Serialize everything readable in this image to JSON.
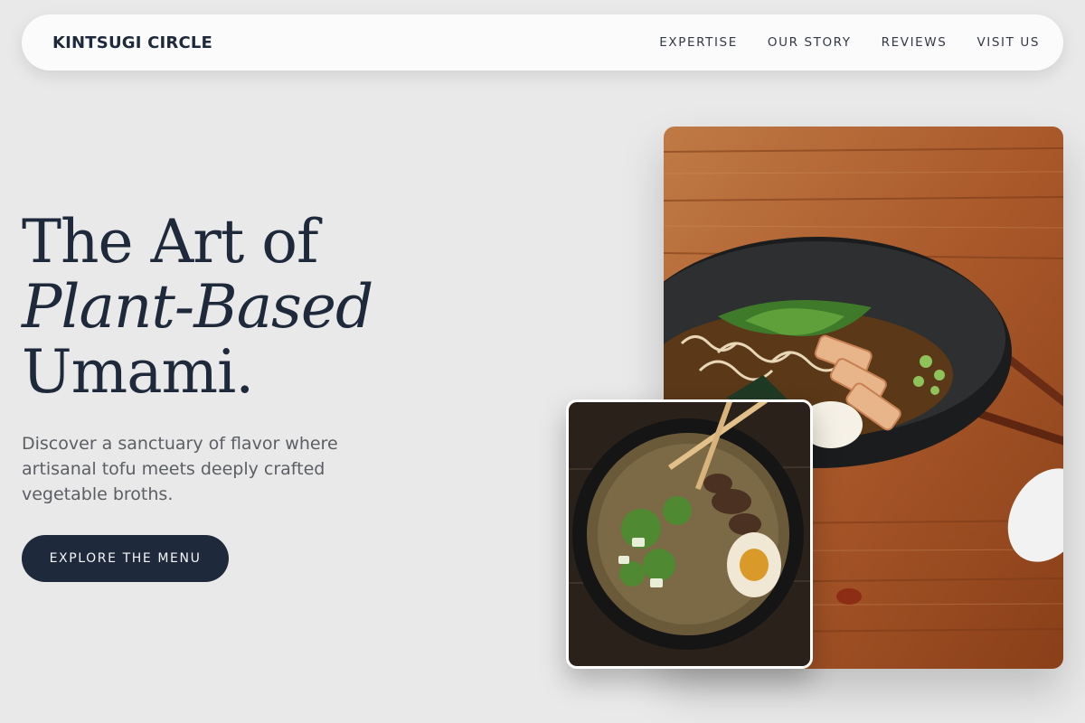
{
  "brand": {
    "name": "KINTSUGI CIRCLE"
  },
  "nav": {
    "items": [
      {
        "label": "EXPERTISE"
      },
      {
        "label": "OUR STORY"
      },
      {
        "label": "REVIEWS"
      },
      {
        "label": "VISIT US"
      }
    ]
  },
  "hero": {
    "title_line1": "The Art of",
    "title_line2": "Plant-Based",
    "title_line3": "Umami.",
    "subtitle": "Discover a sanctuary of flavor where artisanal tofu meets deeply crafted vegetable broths.",
    "cta_label": "EXPLORE THE MENU"
  },
  "images": {
    "large": "ramen-bowl-on-wooden-table-photo",
    "small": "dark-ramen-bowl-with-chopsticks-photo"
  },
  "colors": {
    "background": "#e9e9e9",
    "navy": "#1e293b",
    "body_text": "#5b5e63",
    "wood": "#b8642a"
  }
}
